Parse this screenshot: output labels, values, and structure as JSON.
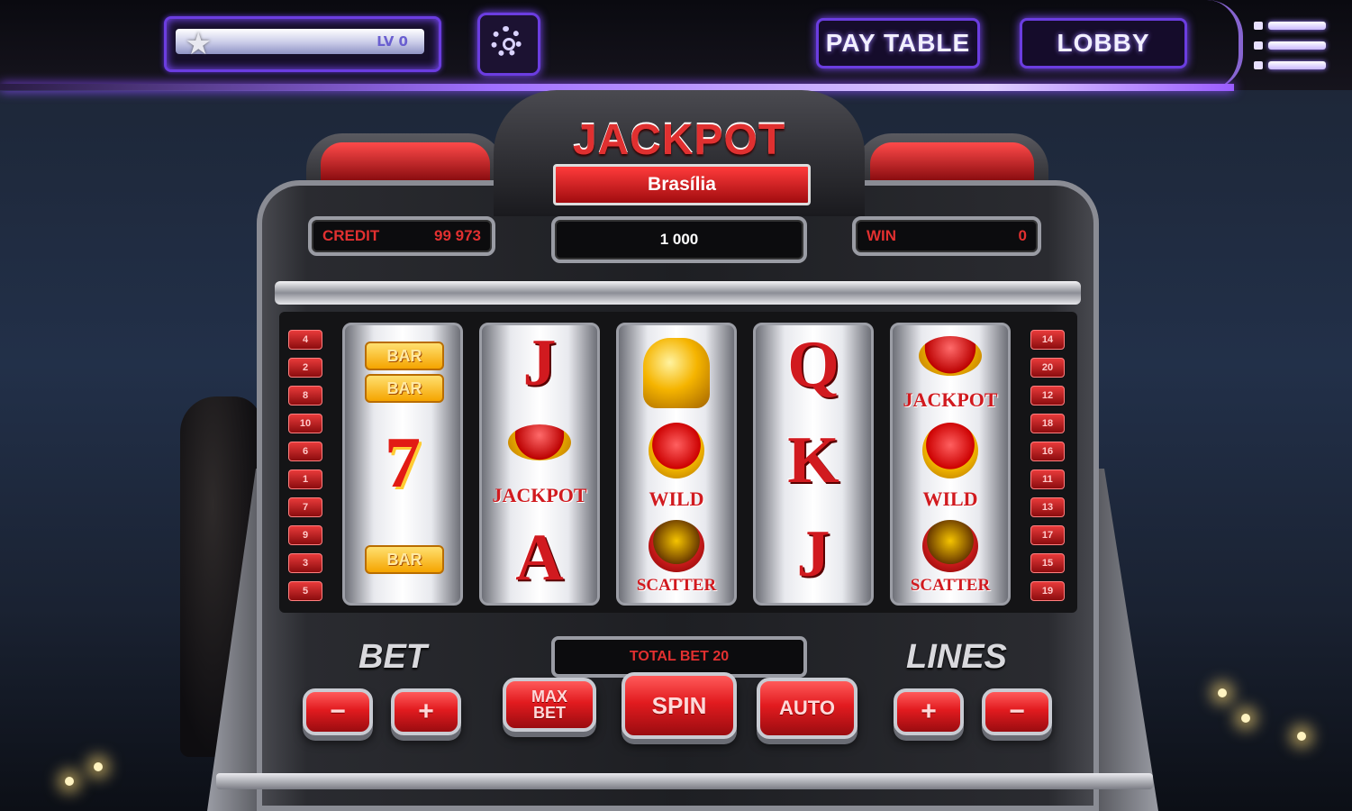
{
  "game_title": "JACKPOT",
  "machine_name": "Brasília",
  "top_bar": {
    "level_label": "LV 0",
    "level_progress": 0.0,
    "pay_table_label": "PAY TABLE",
    "lobby_label": "LOBBY"
  },
  "displays": {
    "credit_label": "CREDIT",
    "credit_value": "99 973",
    "jackpot_value": "1 000",
    "win_label": "WIN",
    "win_value": "0"
  },
  "reels": [
    [
      "BAR BAR",
      "7",
      "BAR"
    ],
    [
      "J",
      "JACKPOT",
      "A"
    ],
    [
      "BELL",
      "WILD",
      "SCATTER"
    ],
    [
      "Q",
      "K",
      "J"
    ],
    [
      "JACKPOT",
      "WILD",
      "SCATTER"
    ]
  ],
  "symbol_text": {
    "bar": "BAR",
    "seven": "7",
    "jackpot": "JACKPOT",
    "wild": "WILD",
    "scatter": "SCATTER",
    "j": "J",
    "a": "A",
    "q": "Q",
    "k": "K"
  },
  "line_numbers_left": [
    "4",
    "2",
    "8",
    "10",
    "6",
    "1",
    "7",
    "9",
    "3",
    "5"
  ],
  "line_numbers_right": [
    "14",
    "20",
    "12",
    "18",
    "16",
    "11",
    "13",
    "17",
    "15",
    "19"
  ],
  "controls": {
    "bet_title": "BET",
    "lines_title": "LINES",
    "total_bet_label": "TOTAL BET 20",
    "minus": "−",
    "plus": "+",
    "max_bet_label": "MAX BET",
    "spin_label": "SPIN",
    "auto_label": "AUTO"
  },
  "colors": {
    "accent_purple": "#7d4bff",
    "cabinet_red": "#e21b1f",
    "gold": "#f5a400"
  }
}
